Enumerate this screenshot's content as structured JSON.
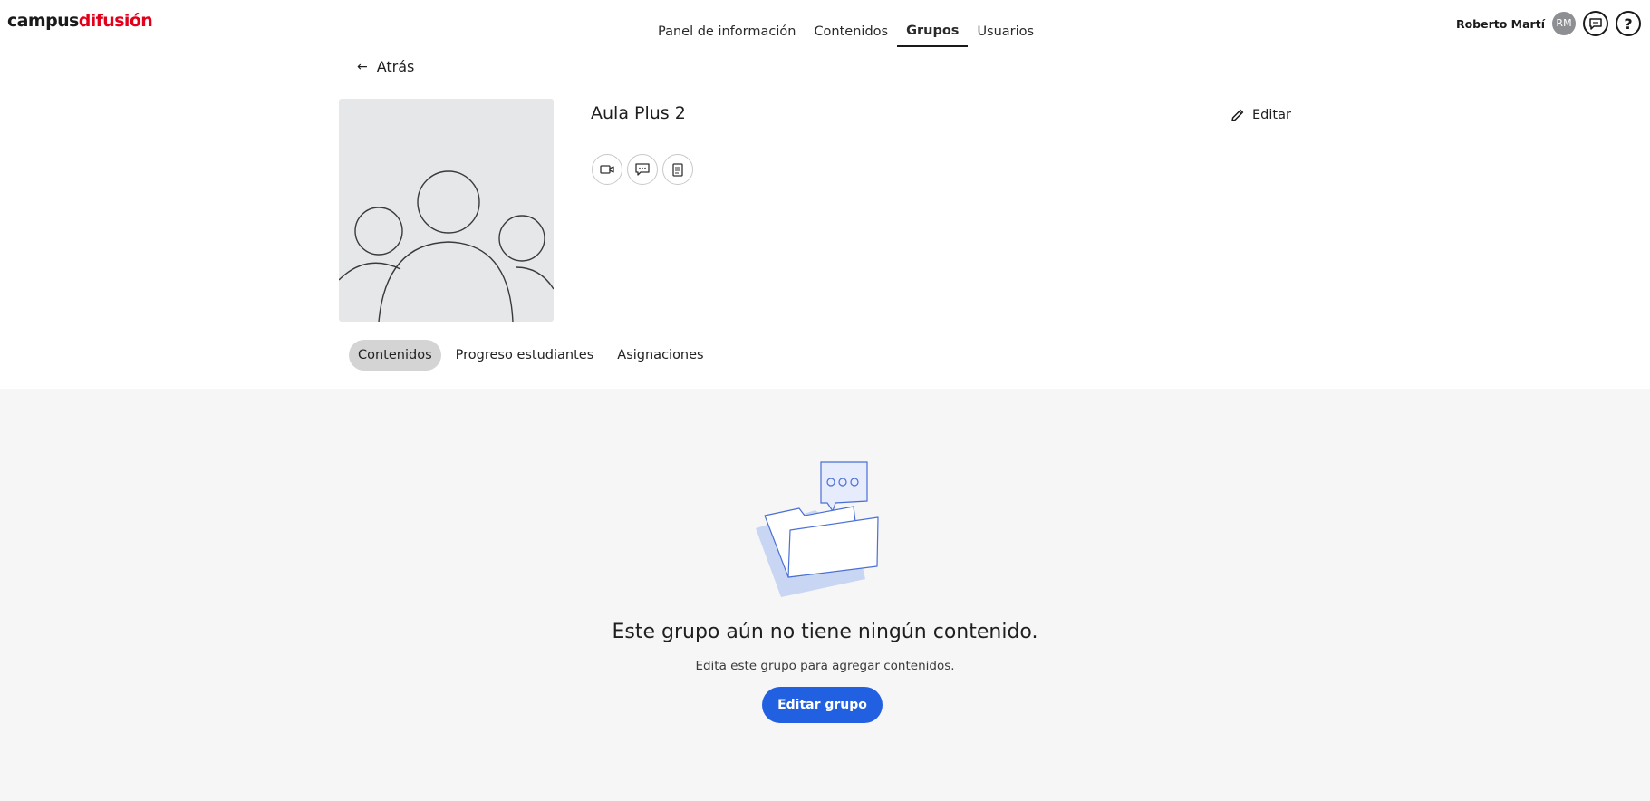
{
  "app": {
    "logo_part1": "campus",
    "logo_part2": "difusión"
  },
  "nav": {
    "items": [
      {
        "label": "Panel de información"
      },
      {
        "label": "Contenidos"
      },
      {
        "label": "Grupos"
      },
      {
        "label": "Usuarios"
      }
    ],
    "active": "Grupos"
  },
  "user": {
    "name": "Roberto Martí",
    "initials": "RM",
    "chat_icon": "chat-icon",
    "help_label": "?"
  },
  "back": {
    "label": "Atrás"
  },
  "group": {
    "title": "Aula Plus 2",
    "edit_label": "Editar",
    "actions": [
      "video-icon",
      "chat-icon",
      "document-icon"
    ]
  },
  "tabs": [
    {
      "label": "Contenidos",
      "active": true
    },
    {
      "label": "Progreso estudiantes",
      "active": false
    },
    {
      "label": "Asignaciones",
      "active": false
    }
  ],
  "empty_state": {
    "title": "Este grupo aún no tiene ningún contenido.",
    "subtitle": "Edita este grupo para agregar contenidos.",
    "button_label": "Editar grupo"
  },
  "colors": {
    "brand_red": "#e3001b",
    "accent_blue": "#2160e0"
  }
}
